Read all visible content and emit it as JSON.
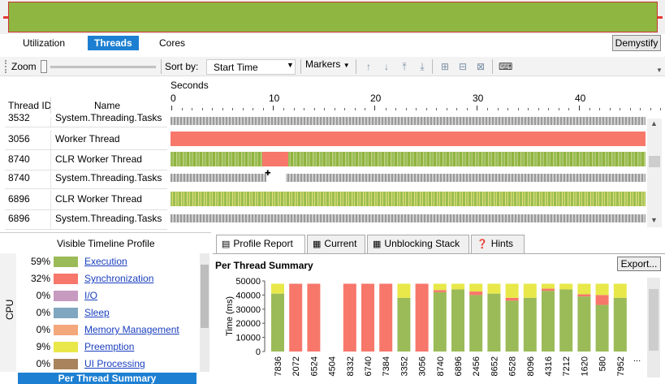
{
  "view_tabs": [
    "Utilization",
    "Threads",
    "Cores"
  ],
  "active_view_tab": "Threads",
  "demystify_label": "Demystify",
  "toolbar": {
    "zoom_label": "Zoom",
    "sort_by_label": "Sort by:",
    "sort_by_value": "Start Time",
    "markers_label": "Markers"
  },
  "timeline": {
    "thread_id_header": "Thread ID",
    "name_header": "Name",
    "axis_label": "Seconds",
    "ticks": [
      "0",
      "10",
      "20",
      "30",
      "40"
    ],
    "rows": [
      {
        "id": "3532",
        "name": "System.Threading.Tasks",
        "lane": "gray"
      },
      {
        "id": "3056",
        "name": "Worker Thread",
        "lane": "sync"
      },
      {
        "id": "8740",
        "name": "CLR Worker Thread",
        "lane": "exec"
      },
      {
        "id": "8740",
        "name": "System.Threading.Tasks",
        "lane": "gray"
      },
      {
        "id": "6896",
        "name": "CLR Worker Thread",
        "lane": "mixed"
      },
      {
        "id": "6896",
        "name": "System.Threading.Tasks",
        "lane": "gray"
      }
    ]
  },
  "profile": {
    "title": "Visible Timeline Profile",
    "cpu_label": "CPU",
    "categories": [
      {
        "pct": "59%",
        "label": "Execution",
        "color": "#9bbb59"
      },
      {
        "pct": "32%",
        "label": "Synchronization",
        "color": "#f7776b"
      },
      {
        "pct": "0%",
        "label": "I/O",
        "color": "#c79ac0"
      },
      {
        "pct": "0%",
        "label": "Sleep",
        "color": "#7fa7c0"
      },
      {
        "pct": "0%",
        "label": "Memory Management",
        "color": "#f4a77a"
      },
      {
        "pct": "9%",
        "label": "Preemption",
        "color": "#e8e84a"
      },
      {
        "pct": "0%",
        "label": "UI Processing",
        "color": "#a8835c"
      }
    ],
    "selected_item": "Per Thread Summary"
  },
  "report_tabs": [
    {
      "label": "Profile Report",
      "icon": "chart-icon"
    },
    {
      "label": "Current",
      "icon": "stack-icon"
    },
    {
      "label": "Unblocking Stack",
      "icon": "stack-icon"
    },
    {
      "label": "Hints",
      "icon": "help-icon"
    }
  ],
  "active_report_tab": "Profile Report",
  "report": {
    "title": "Per Thread Summary",
    "export_label": "Export..."
  },
  "chart_data": {
    "type": "bar",
    "stacked": true,
    "ylabel": "Time (ms)",
    "ylim": [
      0,
      50000
    ],
    "yticks": [
      "0",
      "10000",
      "20000",
      "30000",
      "40000",
      "50000"
    ],
    "categories": [
      "7836",
      "2072",
      "6524",
      "4504",
      "8332",
      "6740",
      "7384",
      "3352",
      "3056",
      "8740",
      "6896",
      "2456",
      "8652",
      "6528",
      "8096",
      "4316",
      "7212",
      "1620",
      "580",
      "7952"
    ],
    "trailing_label": "...",
    "series": [
      {
        "name": "Execution",
        "color": "#9bbb59",
        "values": [
          41000,
          0,
          0,
          0,
          0,
          0,
          0,
          38000,
          0,
          42000,
          44000,
          40000,
          41000,
          36000,
          38000,
          43000,
          44000,
          39000,
          33000,
          38000
        ]
      },
      {
        "name": "Synchronization",
        "color": "#f7776b",
        "values": [
          0,
          48000,
          48000,
          0,
          48000,
          48000,
          48000,
          0,
          48000,
          1500,
          0,
          2500,
          0,
          2000,
          0,
          1500,
          0,
          1500,
          7000,
          0
        ]
      },
      {
        "name": "Preemption",
        "color": "#e8e84a",
        "values": [
          7000,
          0,
          0,
          0,
          0,
          0,
          0,
          10000,
          0,
          4500,
          4000,
          5500,
          7000,
          10000,
          10000,
          3500,
          4000,
          7500,
          8000,
          10000
        ]
      }
    ]
  }
}
